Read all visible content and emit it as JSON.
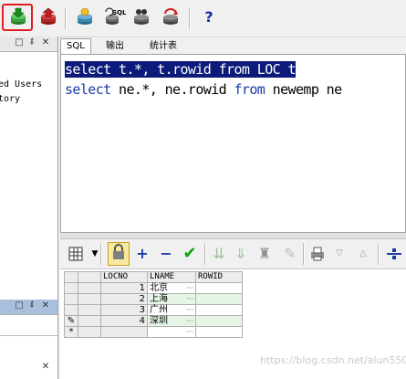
{
  "toolbar": {
    "buttons": [
      {
        "icon": "import-icon"
      },
      {
        "icon": "export-icon"
      },
      {
        "icon": "database-icon"
      },
      {
        "icon": "sql-icon",
        "label": "SQL"
      },
      {
        "icon": "users-icon"
      },
      {
        "icon": "refresh-icon"
      },
      {
        "icon": "help-icon",
        "label": "?"
      }
    ]
  },
  "left_panel": {
    "tree_items": [
      "ed Users",
      "tory"
    ]
  },
  "tabs": [
    "SQL",
    "输出",
    "统计表"
  ],
  "editor": {
    "line1": {
      "kw": "select",
      "rest": " t.*, t.rowid from LOC t"
    },
    "line2": {
      "kw1": "select",
      "mid": " ne.*, ne.rowid ",
      "kw2": "from",
      "rest": " newemp ne"
    }
  },
  "grid": {
    "columns": [
      "LOCNO",
      "LNAME",
      "ROWID"
    ],
    "rows": [
      {
        "marker": "",
        "locno": "1",
        "lname": "北京"
      },
      {
        "marker": "",
        "locno": "2",
        "lname": "上海"
      },
      {
        "marker": "",
        "locno": "3",
        "lname": "广州"
      },
      {
        "marker": "✎",
        "locno": "4",
        "lname": "深圳"
      },
      {
        "marker": "*",
        "locno": "",
        "lname": ""
      }
    ],
    "ellipsis": "···"
  },
  "watermark": "https://blog.csdn.net/alun550",
  "colors": {
    "highlight_box": "#e02020",
    "selection": "#0c1a7a",
    "keyword": "#1a3aa8",
    "grid_row_alt": "#e6f6e6"
  }
}
